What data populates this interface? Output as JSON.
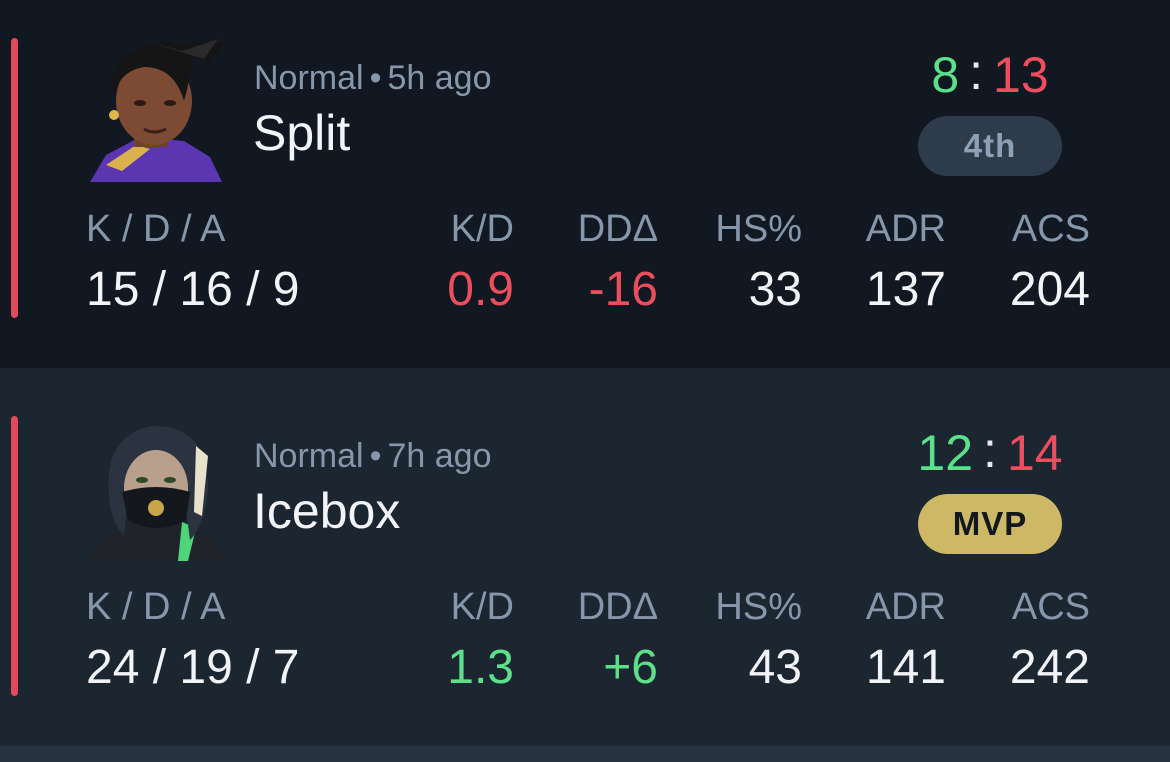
{
  "matches": [
    {
      "mode": "Normal",
      "time_ago": "5h ago",
      "map": "Split",
      "agent_icon": "agent-portrait-icon",
      "score_team": "8",
      "score_enemy": "13",
      "placement": "4th",
      "kda_label": "K / D / A",
      "kda": "15 / 16 / 9",
      "kd_label": "K/D",
      "kd": "0.9",
      "dda_label": "DDΔ",
      "dda": "-16",
      "hs_label": "HS%",
      "hs": "33",
      "adr_label": "ADR",
      "adr": "137",
      "acs_label": "ACS",
      "acs": "204"
    },
    {
      "mode": "Normal",
      "time_ago": "7h ago",
      "map": "Icebox",
      "agent_icon": "agent-portrait-icon",
      "score_team": "12",
      "score_enemy": "14",
      "placement": "MVP",
      "kda_label": "K / D / A",
      "kda": "24 / 19 / 7",
      "kd_label": "K/D",
      "kd": "1.3",
      "dda_label": "DDΔ",
      "dda": "+6",
      "hs_label": "HS%",
      "hs": "43",
      "adr_label": "ADR",
      "adr": "141",
      "acs_label": "ACS",
      "acs": "242"
    }
  ],
  "colors": {
    "loss_accent": "#e14a5b",
    "win_text": "#5ce08a",
    "loss_text": "#ec4e5d",
    "mvp_badge": "#cdb866",
    "rank_badge": "#2e3b4b"
  }
}
